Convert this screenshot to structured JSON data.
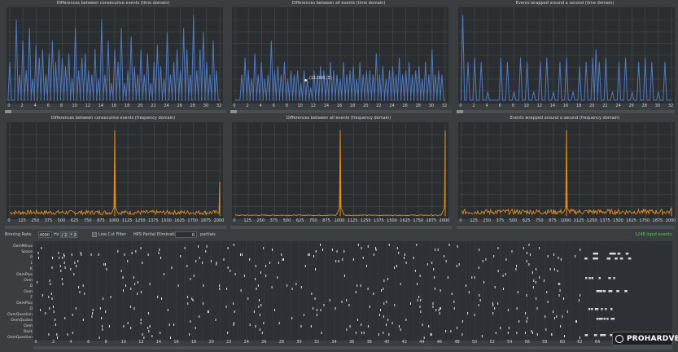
{
  "colors": {
    "time_series": "#4f79c2",
    "freq_series": "#e08a1e",
    "grid": "#4a4d51",
    "plot_bg": "#2b2e31",
    "count_green": "#4fd24f",
    "note": "#e8e8e8"
  },
  "time_panels": [
    {
      "title": "Differences between consecutive events (time domain)"
    },
    {
      "title": "Differences between all events (time domain)",
      "tooltip": "(11.000, 5)"
    },
    {
      "title": "Events wrapped around a second (time domain)"
    }
  ],
  "freq_panels": [
    {
      "title": "Differences between consecutive events (frequency domain)"
    },
    {
      "title": "Differences between all events (frequency domain)"
    },
    {
      "title": "Events wrapped around a second (frequency domain)"
    }
  ],
  "time_ticks": [
    "0",
    "2",
    "4",
    "6",
    "8",
    "10",
    "12",
    "14",
    "16",
    "18",
    "20",
    "22",
    "24",
    "26",
    "28",
    "30",
    "32"
  ],
  "freq_ticks": [
    "0",
    "125",
    "250",
    "375",
    "500",
    "625",
    "750",
    "875",
    "1000",
    "1125",
    "1250",
    "1375",
    "1500",
    "1625",
    "1750",
    "1875",
    "2000"
  ],
  "chart_data": [
    {
      "type": "line",
      "title": "Differences between consecutive events (time domain)",
      "xlim": [
        0,
        32
      ],
      "x": [
        0,
        1,
        1.5,
        2,
        2.5,
        3,
        3.5,
        4,
        4.5,
        5,
        5.5,
        6,
        6.5,
        7,
        7.5,
        8,
        8.5,
        9,
        9.5,
        10,
        10.5,
        11,
        11.5,
        12,
        12.5,
        13,
        13.5,
        14,
        14.5,
        15,
        15.5,
        16,
        16.5,
        17,
        17.5,
        18,
        18.5,
        19,
        19.5,
        20,
        20.5,
        21,
        21.5,
        22,
        22.5,
        23,
        23.5,
        24,
        24.5,
        25,
        25.5,
        26,
        26.5,
        27,
        27.5,
        28,
        28.5,
        29,
        29.5,
        30,
        30.5,
        31,
        31.5
      ],
      "y": [
        0.45,
        0.95,
        0.3,
        0.7,
        0.35,
        0.85,
        0.25,
        0.65,
        0.5,
        0.6,
        0.3,
        0.55,
        0.7,
        0.45,
        0.6,
        0.5,
        0.4,
        0.55,
        0.25,
        0.85,
        0.35,
        0.5,
        0.55,
        0.35,
        0.3,
        0.6,
        0.25,
        0.95,
        0.3,
        0.7,
        0.2,
        0.6,
        0.45,
        0.85,
        0.2,
        0.35,
        0.75,
        0.4,
        0.3,
        0.6,
        0.3,
        0.55,
        0.2,
        0.45,
        0.65,
        0.4,
        0.25,
        0.8,
        0.3,
        0.45,
        0.6,
        0.35,
        0.85,
        0.6,
        0.3,
        1.0,
        0.35,
        0.6,
        0.8,
        0.45,
        0.3,
        0.7,
        0.35
      ]
    },
    {
      "type": "line",
      "title": "Differences between all events (time domain)",
      "xlim": [
        0,
        32
      ],
      "x": [
        1,
        1.5,
        2,
        2.5,
        3,
        3.5,
        4,
        4.5,
        5,
        5.5,
        6,
        6.5,
        7,
        7.5,
        8,
        8.5,
        9,
        9.5,
        10,
        10.5,
        11,
        11.5,
        12,
        12.5,
        13,
        13.5,
        14,
        14.5,
        15,
        15.5,
        16,
        16.5,
        17,
        17.5,
        18,
        18.5,
        19,
        19.5,
        20,
        20.5,
        21,
        21.5,
        22,
        22.5,
        23,
        23.5,
        24,
        24.5,
        25,
        25.5,
        26,
        26.5,
        27,
        27.5,
        28,
        28.5,
        29,
        29.5,
        30,
        30.5,
        31,
        31.5
      ],
      "y": [
        0.3,
        0.5,
        0.35,
        0.25,
        0.55,
        0.3,
        0.45,
        0.25,
        0.3,
        0.7,
        0.35,
        0.4,
        0.3,
        0.45,
        0.25,
        0.35,
        0.3,
        0.35,
        0.2,
        0.35,
        0.25,
        0.15,
        0.35,
        0.3,
        0.4,
        0.35,
        0.3,
        0.45,
        0.35,
        0.3,
        0.25,
        0.45,
        0.3,
        0.35,
        0.4,
        0.25,
        0.45,
        0.3,
        0.35,
        0.35,
        0.3,
        0.55,
        0.3,
        0.4,
        0.25,
        0.35,
        0.4,
        0.3,
        0.5,
        0.3,
        0.35,
        0.45,
        0.3,
        0.35,
        0.4,
        0.25,
        0.45,
        0.3,
        0.6,
        0.3,
        0.35,
        0.3
      ]
    },
    {
      "type": "line",
      "title": "Events wrapped around a second (time domain)",
      "xlim": [
        0,
        32
      ],
      "x": [
        0.2,
        1,
        2,
        3,
        4,
        6,
        7,
        8,
        9,
        10,
        11,
        12,
        13,
        14,
        15,
        16,
        17,
        18,
        19,
        20,
        20.5,
        21,
        22,
        23,
        24,
        25,
        26,
        27,
        28,
        29,
        30,
        31
      ],
      "y": [
        1.0,
        0.45,
        0.5,
        0.45,
        0.1,
        0.5,
        0.45,
        0.1,
        0.5,
        0.45,
        0.1,
        0.45,
        0.5,
        0.1,
        0.45,
        0.5,
        0.1,
        0.4,
        0.45,
        0.5,
        0.6,
        0.45,
        0.5,
        0.1,
        0.45,
        0.5,
        0.1,
        0.45,
        0.5,
        0.45,
        0.1,
        0.45
      ]
    },
    {
      "type": "line",
      "title": "Differences between consecutive events (frequency domain)",
      "xlim": [
        0,
        2000
      ],
      "peaks": [
        {
          "x": 1000,
          "y": 1.0
        },
        {
          "x": 2000,
          "y": 0.4
        }
      ],
      "noise_level": 0.05
    },
    {
      "type": "line",
      "title": "Differences between all events (frequency domain)",
      "xlim": [
        0,
        2000
      ],
      "peaks": [
        {
          "x": 1000,
          "y": 1.0
        },
        {
          "x": 2000,
          "y": 1.0
        }
      ],
      "noise_level": 0.01
    },
    {
      "type": "line",
      "title": "Events wrapped around a second (frequency domain)",
      "xlim": [
        0,
        2000
      ],
      "peaks": [
        {
          "x": 1000,
          "y": 1.0
        },
        {
          "x": 2000,
          "y": 0.1
        }
      ],
      "noise_level": 0.06
    }
  ],
  "controls": {
    "binning_rate_label": "Binning Rate:",
    "binning_rate_value": "4000",
    "binning_rate_unit": "Hz",
    "div2_label": "/ 2",
    "mul2_label": "* 2",
    "low_cut_label": "Low Cut Filter",
    "hps_label": "HPS Partial Elimination:",
    "hps_value": "0",
    "partials_label": "partials",
    "input_events": "1248 input events"
  },
  "roll": {
    "labels": [
      "OemMinus",
      "Space",
      "P",
      "L",
      "K",
      "OemPlus",
      "Oem",
      "D",
      "Oem",
      "F",
      "OemPlus",
      "O",
      "OemQuestion",
      "OemQuotes",
      "Oem",
      "Back",
      "OemQuestion"
    ],
    "ticks": [
      "0",
      "2",
      "4",
      "6",
      "8",
      "10",
      "12",
      "14",
      "16",
      "18",
      "20",
      "22",
      "24",
      "26",
      "28",
      "30",
      "32",
      "34",
      "36",
      "38",
      "40",
      "42",
      "44",
      "46",
      "48",
      "50",
      "52",
      "54",
      "56",
      "58",
      "60",
      "62",
      "64"
    ]
  },
  "watermark": "PROHARDVER!"
}
